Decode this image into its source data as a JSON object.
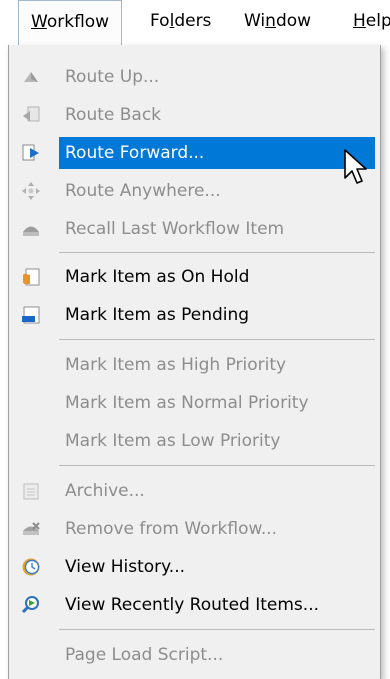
{
  "menubar": {
    "items": [
      {
        "label_pre": "",
        "label_u": "W",
        "label_post": "orkflow"
      },
      {
        "label_pre": "Fo",
        "label_u": "l",
        "label_post": "ders"
      },
      {
        "label_pre": "Wi",
        "label_u": "n",
        "label_post": "dow"
      },
      {
        "label_pre": "",
        "label_u": "H",
        "label_post": "elp"
      }
    ]
  },
  "menu": {
    "items": [
      {
        "label": "Route Up...",
        "icon": "route-up-icon",
        "state": "disabled"
      },
      {
        "label": "Route Back",
        "icon": "route-back-icon",
        "state": "disabled"
      },
      {
        "label": "Route Forward...",
        "icon": "route-forward-icon",
        "state": "highlighted"
      },
      {
        "label": "Route Anywhere...",
        "icon": "route-anywhere-icon",
        "state": "disabled"
      },
      {
        "label": "Recall Last Workflow Item",
        "icon": "recall-icon",
        "state": "disabled"
      },
      {
        "label": "Mark Item as On Hold",
        "icon": "on-hold-icon",
        "state": "enabled"
      },
      {
        "label": "Mark Item as Pending",
        "icon": "pending-icon",
        "state": "enabled"
      },
      {
        "label": "Mark Item as High Priority",
        "state": "disabled"
      },
      {
        "label": "Mark Item as Normal Priority",
        "state": "disabled"
      },
      {
        "label": "Mark Item as Low Priority",
        "state": "disabled"
      },
      {
        "label": "Archive...",
        "icon": "archive-icon",
        "state": "disabled"
      },
      {
        "label": "Remove from Workflow...",
        "icon": "remove-workflow-icon",
        "state": "disabled"
      },
      {
        "label": "View History...",
        "icon": "history-clock-icon",
        "state": "enabled"
      },
      {
        "label": "View Recently Routed Items...",
        "icon": "recently-routed-icon",
        "state": "enabled"
      },
      {
        "label": "Page Load Script...",
        "state": "disabled"
      }
    ]
  },
  "colors": {
    "highlight": "#0078d7",
    "disabled_text": "#8d8d8d",
    "menu_background": "#f0f0f0"
  }
}
